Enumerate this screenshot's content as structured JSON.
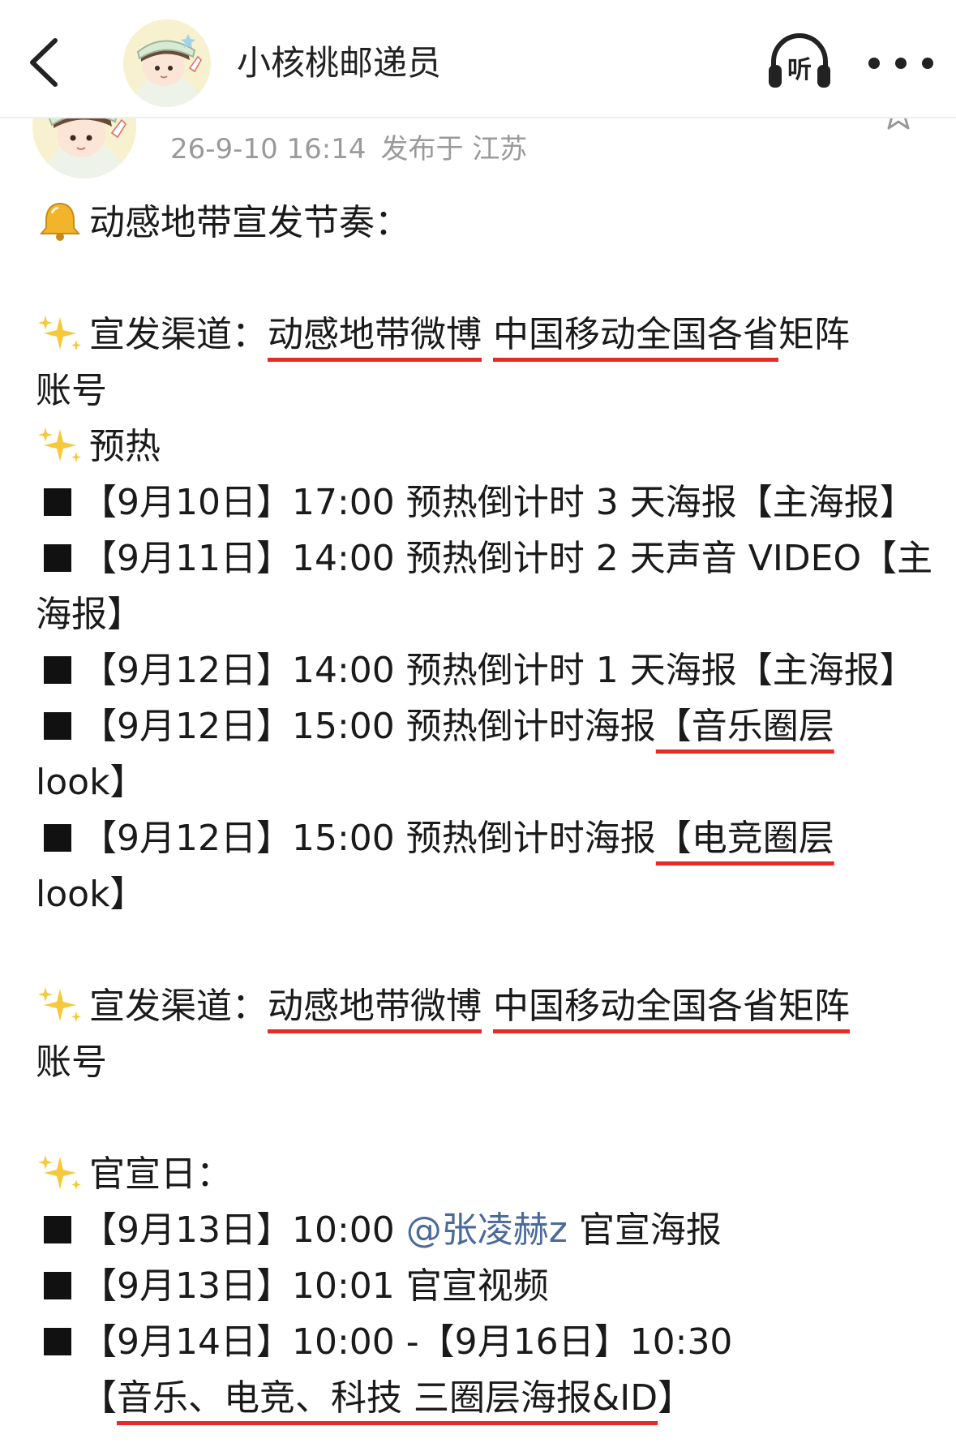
{
  "nav": {
    "title": "小核桃邮递员",
    "listen_label": "听"
  },
  "post": {
    "date": "26-9-10 16:14",
    "location": "发布于 江苏"
  },
  "body": {
    "heading": "动感地带宣发节奏：",
    "sec1": {
      "label": "宣发渠道：",
      "channel1": "动感地带微博",
      "channel2": "中国移动全国各省",
      "channel2_rest": "矩阵",
      "continuation": "账号"
    },
    "sec2": {
      "label": "预热",
      "items": [
        "【9月10日】17:00 预热倒计时 3 天海报【主海报】",
        "【9月11日】14:00 预热倒计时 2 天声音 VIDEO【主",
        "海报】",
        "【9月12日】14:00 预热倒计时 1 天海报【主海报】"
      ],
      "item5_pre": "【9月12日】15:00 预热倒计时海报",
      "item5_ul": "【音乐圈层",
      "item5_cont": "look】",
      "item6_pre": "【9月12日】15:00 预热倒计时海报",
      "item6_ul": "【电竞圈层",
      "item6_cont": "look】"
    },
    "sec3": {
      "label": "宣发渠道：",
      "channel1": "动感地带微博",
      "channel2": "中国移动全国各省矩阵",
      "continuation": "账号"
    },
    "sec4": {
      "label": "官宣日：",
      "item1_pre": "【9月13日】10:00 ",
      "item1_mention": "@张凌赫z",
      "item1_post": " 官宣海报",
      "item2": "【9月13日】10:01 官宣视频",
      "item3": "【9月14日】10:00 -【9月16日】10:30",
      "item3_open": "【",
      "item3_ul": "音乐、电竞、科技 三圈层海报&ID",
      "item3_close": "】"
    }
  },
  "colors": {
    "underline": "#ec2727",
    "mention": "#4b6a9b",
    "meta": "#9a9a9a"
  },
  "icons": [
    "back-chevron-icon",
    "avatar-icon",
    "headphones-icon",
    "more-icon",
    "bell-icon",
    "sparkles-icon",
    "star-icon"
  ]
}
